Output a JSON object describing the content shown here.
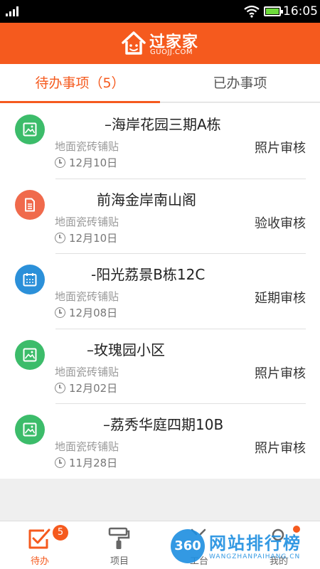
{
  "status_bar": {
    "time": "16:05"
  },
  "brand": {
    "name": "过家家",
    "domain": "GUOJJ.COM",
    "color": "#f55a1e"
  },
  "tabs": [
    {
      "label": "待办事项（5）",
      "active": true
    },
    {
      "label": "已办事项",
      "active": false
    }
  ],
  "tasks": [
    {
      "title": "–海岸花园三期A栋",
      "category": "地面瓷砖铺贴",
      "date": "12月10日",
      "status": "照片审核",
      "icon": "image-icon",
      "icon_color": "#3cbc6a"
    },
    {
      "title": "前海金岸南山阁",
      "category": "地面瓷砖铺贴",
      "date": "12月10日",
      "status": "验收审核",
      "icon": "document-icon",
      "icon_color": "#f06a4c"
    },
    {
      "title": "-阳光荔景B栋12C",
      "category": "地面瓷砖铺贴",
      "date": "12月08日",
      "status": "延期审核",
      "icon": "calendar-icon",
      "icon_color": "#2b90d9"
    },
    {
      "title": "–玫瑰园小区",
      "category": "地面瓷砖铺贴",
      "date": "12月02日",
      "status": "照片审核",
      "icon": "image-icon",
      "icon_color": "#3cbc6a"
    },
    {
      "title": "–荔秀华庭四期10B",
      "category": "地面瓷砖铺贴",
      "date": "11月28日",
      "status": "照片审核",
      "icon": "image-icon",
      "icon_color": "#3cbc6a"
    }
  ],
  "bottom_nav": {
    "items": [
      {
        "label": "待办",
        "icon": "checkbox-edit-icon",
        "active": true,
        "badge": "5"
      },
      {
        "label": "项目",
        "icon": "paint-roller-icon",
        "active": false
      },
      {
        "label": "工台",
        "icon": "workbench-icon",
        "active": false
      },
      {
        "label": "我的",
        "icon": "profile-icon",
        "active": false
      }
    ]
  },
  "watermark": {
    "logo": "360",
    "text": "网站排行榜",
    "url": "WANGZHANPAIHANG.CN"
  }
}
